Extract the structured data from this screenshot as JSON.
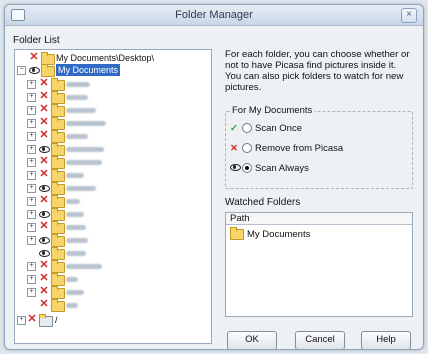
{
  "window": {
    "title": "Folder Manager"
  },
  "folder_list_label": "Folder List",
  "tree": {
    "root": "My Documents\\Desktop\\",
    "selected": "My Documents",
    "last_item": "/"
  },
  "description": "For each folder, you can choose whether or not to have Picasa find pictures inside it. You can also pick folders to watch for new pictures.",
  "options_group": {
    "title": "For My Documents",
    "options": [
      "Scan Once",
      "Remove from Picasa",
      "Scan Always"
    ],
    "selected_index": 2
  },
  "watched": {
    "label": "Watched Folders",
    "column": "Path",
    "rows": [
      "My Documents"
    ]
  },
  "buttons": {
    "ok": "OK",
    "cancel": "Cancel",
    "help": "Help"
  },
  "icons": {
    "check": "check-icon",
    "remove": "x-icon",
    "watch": "eye-icon"
  },
  "colors": {
    "selection": "#316ac5",
    "remove": "#d42a2a",
    "check": "#2fa33a"
  }
}
